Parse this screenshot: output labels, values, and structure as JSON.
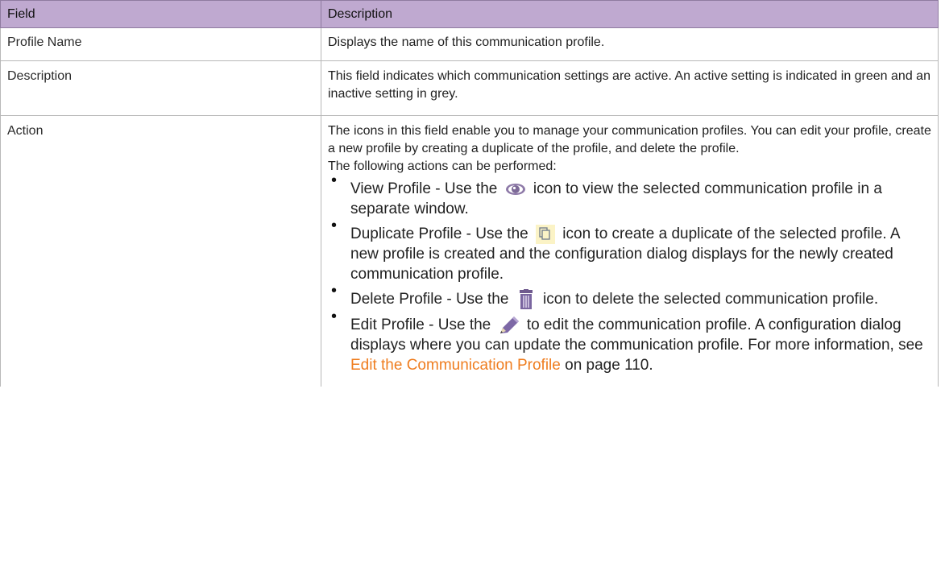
{
  "table": {
    "headers": [
      "Field",
      "Description"
    ],
    "rows": [
      {
        "field": "Profile Name",
        "description": "Displays the name of this communication profile."
      },
      {
        "field": "Description",
        "description": "This field indicates which communication settings are active. An active setting is indicated in green and an inactive setting in grey."
      },
      {
        "field": "Action",
        "description": "The icons in this field enable you to manage your communication profiles. You can edit your profile, create a new profile by creating a duplicate of the profile, and delete the profile.",
        "intro": "The following actions can be performed:",
        "actions": [
          {
            "before": "View Profile - Use the",
            "icon": "eye-icon",
            "after": "icon to view the selected communication profile in a separate window."
          },
          {
            "before": "Duplicate Profile - Use the",
            "icon": "duplicate-icon",
            "after": "icon to create a duplicate of the selected profile. A new profile is created and the configuration dialog displays for the newly created communication profile."
          },
          {
            "before": "Delete Profile - Use the",
            "icon": "trash-icon",
            "after": "icon to delete the selected communication profile."
          },
          {
            "before": "Edit Profile - Use the",
            "icon": "pencil-icon",
            "after": "to edit the communication profile. A configuration dialog displays where you can update the communication profile. For more information, see",
            "link": "Edit the Communication Profile",
            "tail": "on page 110."
          }
        ]
      }
    ]
  },
  "colors": {
    "header_bg": "#bfa9d0",
    "link": "#ef7d1f",
    "border": "#b8b8b8"
  }
}
